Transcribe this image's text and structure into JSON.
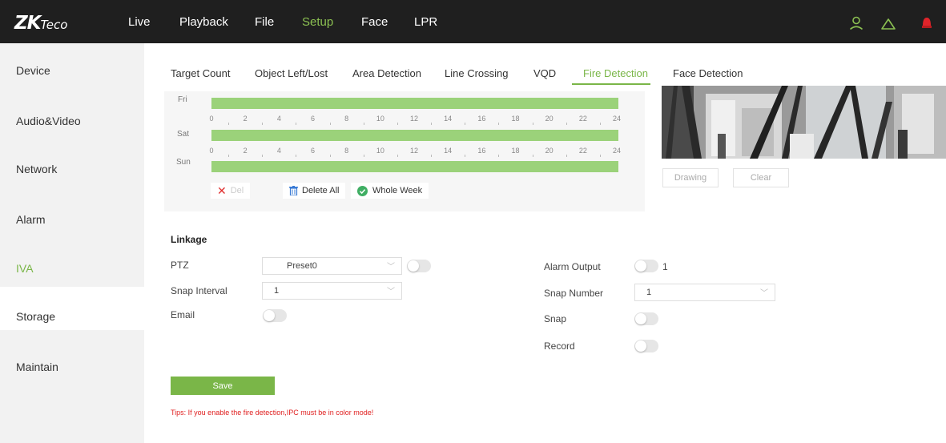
{
  "brand": {
    "logo_main": "ZK",
    "logo_sub": "Teco"
  },
  "nav": [
    "Live",
    "Playback",
    "File",
    "Setup",
    "Face",
    "LPR"
  ],
  "nav_active": "Setup",
  "sidebar": [
    "Device",
    "Audio&Video",
    "Network",
    "Alarm",
    "IVA",
    "Storage",
    "Maintain"
  ],
  "sidebar_active": "IVA",
  "tabs": [
    "Target Count",
    "Object Left/Lost",
    "Area Detection",
    "Line Crossing",
    "VQD",
    "Fire Detection",
    "Face Detection"
  ],
  "tab_active": "Fire Detection",
  "schedule": {
    "days": [
      "Fri",
      "Sat",
      "Sun"
    ],
    "hour_ticks": [
      "0",
      "2",
      "4",
      "6",
      "8",
      "10",
      "12",
      "14",
      "16",
      "18",
      "20",
      "22",
      "24"
    ],
    "actions": {
      "del": "Del",
      "delete_all": "Delete All",
      "whole_week": "Whole Week"
    }
  },
  "preview": {
    "drawing": "Drawing",
    "clear": "Clear"
  },
  "linkage": {
    "title": "Linkage",
    "ptz_label": "PTZ",
    "ptz_value": "Preset0",
    "snap_interval_label": "Snap Interval",
    "snap_interval_value": "1",
    "email_label": "Email",
    "alarm_output_label": "Alarm Output",
    "alarm_output_value": "1",
    "snap_number_label": "Snap Number",
    "snap_number_value": "1",
    "snap_label": "Snap",
    "record_label": "Record"
  },
  "save_label": "Save",
  "tips": "Tips: If you enable the fire detection,IPC must be in color mode!",
  "colors": {
    "accent": "#7ab648",
    "topbar": "#1f1f1f",
    "schedule_bar": "#9bd27a",
    "warning": "#e02020"
  }
}
